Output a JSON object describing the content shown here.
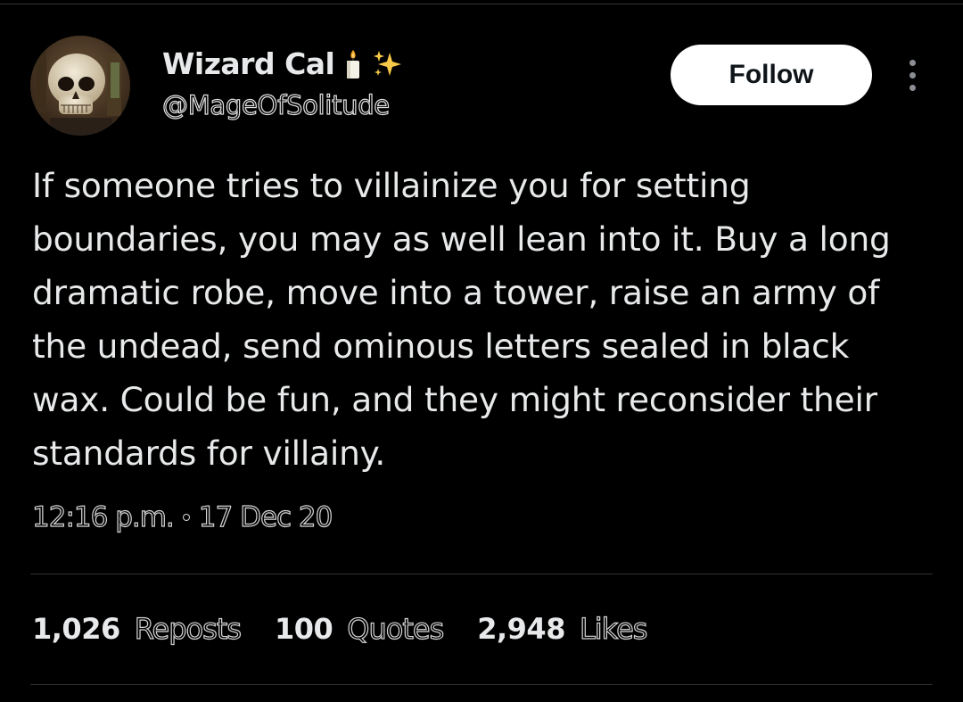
{
  "author": {
    "display_name": "Wizard Cal",
    "name_emojis": [
      "candle-emoji",
      "sparkles-emoji"
    ],
    "handle": "@MageOfSolitude",
    "avatar": "skull-avatar"
  },
  "actions": {
    "follow_label": "Follow",
    "more_icon": "more-dots-icon"
  },
  "tweet": {
    "text": "If someone tries to villainize you for setting boundaries, you may as well lean into it. Buy a long dramatic robe, move into a tower, raise an army of the undead, send ominous letters sealed in black wax. Could be fun, and they might reconsider their standards for villainy.",
    "time": "12:16 p.m.",
    "date": "17 Dec 20"
  },
  "stats": {
    "reposts_count": "1,026",
    "reposts_label": "Reposts",
    "quotes_count": "100",
    "quotes_label": "Quotes",
    "likes_count": "2,948",
    "likes_label": "Likes"
  },
  "colors": {
    "background": "#000000",
    "text": "#e7e9ea",
    "divider": "#2f3336",
    "follow_bg": "#ffffff"
  }
}
